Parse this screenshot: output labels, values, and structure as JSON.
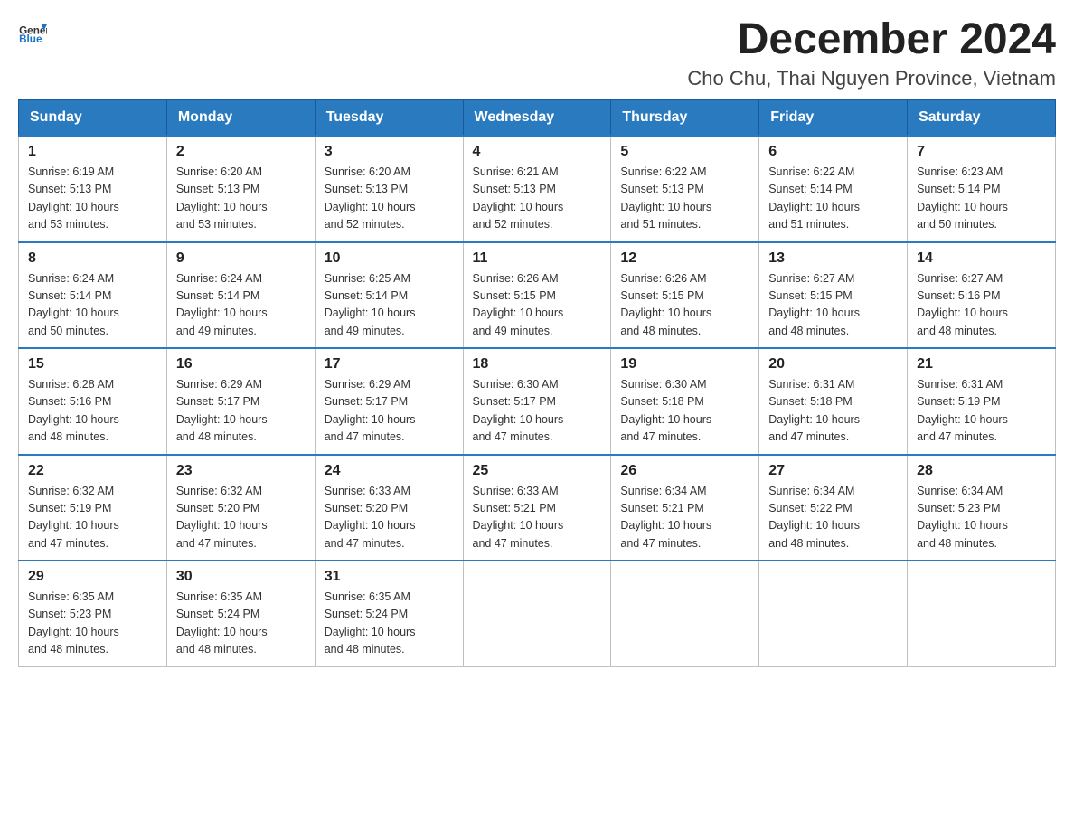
{
  "header": {
    "logo_general": "General",
    "logo_blue": "Blue",
    "month_year": "December 2024",
    "location": "Cho Chu, Thai Nguyen Province, Vietnam"
  },
  "weekdays": [
    "Sunday",
    "Monday",
    "Tuesday",
    "Wednesday",
    "Thursday",
    "Friday",
    "Saturday"
  ],
  "weeks": [
    [
      {
        "day": "1",
        "sunrise": "6:19 AM",
        "sunset": "5:13 PM",
        "daylight": "10 hours and 53 minutes."
      },
      {
        "day": "2",
        "sunrise": "6:20 AM",
        "sunset": "5:13 PM",
        "daylight": "10 hours and 53 minutes."
      },
      {
        "day": "3",
        "sunrise": "6:20 AM",
        "sunset": "5:13 PM",
        "daylight": "10 hours and 52 minutes."
      },
      {
        "day": "4",
        "sunrise": "6:21 AM",
        "sunset": "5:13 PM",
        "daylight": "10 hours and 52 minutes."
      },
      {
        "day": "5",
        "sunrise": "6:22 AM",
        "sunset": "5:13 PM",
        "daylight": "10 hours and 51 minutes."
      },
      {
        "day": "6",
        "sunrise": "6:22 AM",
        "sunset": "5:14 PM",
        "daylight": "10 hours and 51 minutes."
      },
      {
        "day": "7",
        "sunrise": "6:23 AM",
        "sunset": "5:14 PM",
        "daylight": "10 hours and 50 minutes."
      }
    ],
    [
      {
        "day": "8",
        "sunrise": "6:24 AM",
        "sunset": "5:14 PM",
        "daylight": "10 hours and 50 minutes."
      },
      {
        "day": "9",
        "sunrise": "6:24 AM",
        "sunset": "5:14 PM",
        "daylight": "10 hours and 49 minutes."
      },
      {
        "day": "10",
        "sunrise": "6:25 AM",
        "sunset": "5:14 PM",
        "daylight": "10 hours and 49 minutes."
      },
      {
        "day": "11",
        "sunrise": "6:26 AM",
        "sunset": "5:15 PM",
        "daylight": "10 hours and 49 minutes."
      },
      {
        "day": "12",
        "sunrise": "6:26 AM",
        "sunset": "5:15 PM",
        "daylight": "10 hours and 48 minutes."
      },
      {
        "day": "13",
        "sunrise": "6:27 AM",
        "sunset": "5:15 PM",
        "daylight": "10 hours and 48 minutes."
      },
      {
        "day": "14",
        "sunrise": "6:27 AM",
        "sunset": "5:16 PM",
        "daylight": "10 hours and 48 minutes."
      }
    ],
    [
      {
        "day": "15",
        "sunrise": "6:28 AM",
        "sunset": "5:16 PM",
        "daylight": "10 hours and 48 minutes."
      },
      {
        "day": "16",
        "sunrise": "6:29 AM",
        "sunset": "5:17 PM",
        "daylight": "10 hours and 48 minutes."
      },
      {
        "day": "17",
        "sunrise": "6:29 AM",
        "sunset": "5:17 PM",
        "daylight": "10 hours and 47 minutes."
      },
      {
        "day": "18",
        "sunrise": "6:30 AM",
        "sunset": "5:17 PM",
        "daylight": "10 hours and 47 minutes."
      },
      {
        "day": "19",
        "sunrise": "6:30 AM",
        "sunset": "5:18 PM",
        "daylight": "10 hours and 47 minutes."
      },
      {
        "day": "20",
        "sunrise": "6:31 AM",
        "sunset": "5:18 PM",
        "daylight": "10 hours and 47 minutes."
      },
      {
        "day": "21",
        "sunrise": "6:31 AM",
        "sunset": "5:19 PM",
        "daylight": "10 hours and 47 minutes."
      }
    ],
    [
      {
        "day": "22",
        "sunrise": "6:32 AM",
        "sunset": "5:19 PM",
        "daylight": "10 hours and 47 minutes."
      },
      {
        "day": "23",
        "sunrise": "6:32 AM",
        "sunset": "5:20 PM",
        "daylight": "10 hours and 47 minutes."
      },
      {
        "day": "24",
        "sunrise": "6:33 AM",
        "sunset": "5:20 PM",
        "daylight": "10 hours and 47 minutes."
      },
      {
        "day": "25",
        "sunrise": "6:33 AM",
        "sunset": "5:21 PM",
        "daylight": "10 hours and 47 minutes."
      },
      {
        "day": "26",
        "sunrise": "6:34 AM",
        "sunset": "5:21 PM",
        "daylight": "10 hours and 47 minutes."
      },
      {
        "day": "27",
        "sunrise": "6:34 AM",
        "sunset": "5:22 PM",
        "daylight": "10 hours and 48 minutes."
      },
      {
        "day": "28",
        "sunrise": "6:34 AM",
        "sunset": "5:23 PM",
        "daylight": "10 hours and 48 minutes."
      }
    ],
    [
      {
        "day": "29",
        "sunrise": "6:35 AM",
        "sunset": "5:23 PM",
        "daylight": "10 hours and 48 minutes."
      },
      {
        "day": "30",
        "sunrise": "6:35 AM",
        "sunset": "5:24 PM",
        "daylight": "10 hours and 48 minutes."
      },
      {
        "day": "31",
        "sunrise": "6:35 AM",
        "sunset": "5:24 PM",
        "daylight": "10 hours and 48 minutes."
      },
      null,
      null,
      null,
      null
    ]
  ],
  "labels": {
    "sunrise": "Sunrise:",
    "sunset": "Sunset:",
    "daylight": "Daylight:"
  }
}
